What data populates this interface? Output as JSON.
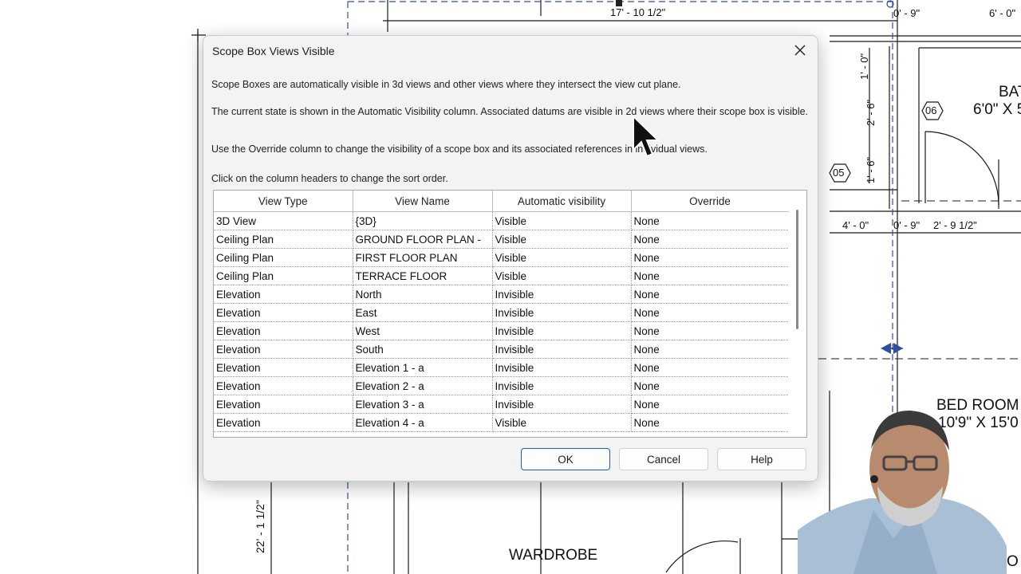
{
  "cad": {
    "dimensions": [
      "17' - 10 1/2\"",
      "0' - 9\"",
      "6' - 0\"",
      "1' - 0\"",
      "2' - 6\"",
      "1' - 6\"",
      "4' - 0\"",
      "0' - 9\"",
      "2' - 9 1/2\"",
      "22' - 1 1/2\""
    ],
    "tags": [
      "06",
      "05"
    ],
    "rooms": {
      "bath_name": "BAT",
      "bath_size": "6'0\" X 5",
      "bed_name": "BED ROOM",
      "bed_size": "10'9\" X 15'0",
      "wardrobe": "WARDROBE",
      "edge_letter": "O"
    }
  },
  "dialog": {
    "title": "Scope Box Views Visible",
    "para1": "Scope Boxes are automatically visible in 3d views and other views where they intersect the view cut plane.",
    "para2": "The current state is shown in the Automatic Visibility column. Associated datums are visible in 2d views where their scope box is visible.",
    "para3": "Use the Override column to change the visibility of a scope box and its associated references in individual views.",
    "para4": "Click on the column headers to change the sort order.",
    "columns": [
      "View Type",
      "View Name",
      "Automatic visibility",
      "Override"
    ],
    "rows": [
      [
        "3D View",
        "{3D}",
        "Visible",
        "None"
      ],
      [
        "Ceiling Plan",
        "GROUND FLOOR PLAN -",
        "Visible",
        "None"
      ],
      [
        "Ceiling Plan",
        "FIRST FLOOR PLAN",
        "Visible",
        "None"
      ],
      [
        "Ceiling Plan",
        "TERRACE FLOOR",
        "Visible",
        "None"
      ],
      [
        "Elevation",
        "North",
        "Invisible",
        "None"
      ],
      [
        "Elevation",
        "East",
        "Invisible",
        "None"
      ],
      [
        "Elevation",
        "West",
        "Invisible",
        "None"
      ],
      [
        "Elevation",
        "South",
        "Invisible",
        "None"
      ],
      [
        "Elevation",
        "Elevation 1 - a",
        "Invisible",
        "None"
      ],
      [
        "Elevation",
        "Elevation 2 - a",
        "Invisible",
        "None"
      ],
      [
        "Elevation",
        "Elevation 3 - a",
        "Invisible",
        "None"
      ],
      [
        "Elevation",
        "Elevation 4 - a",
        "Visible",
        "None"
      ]
    ],
    "buttons": {
      "ok": "OK",
      "cancel": "Cancel",
      "help": "Help"
    }
  }
}
